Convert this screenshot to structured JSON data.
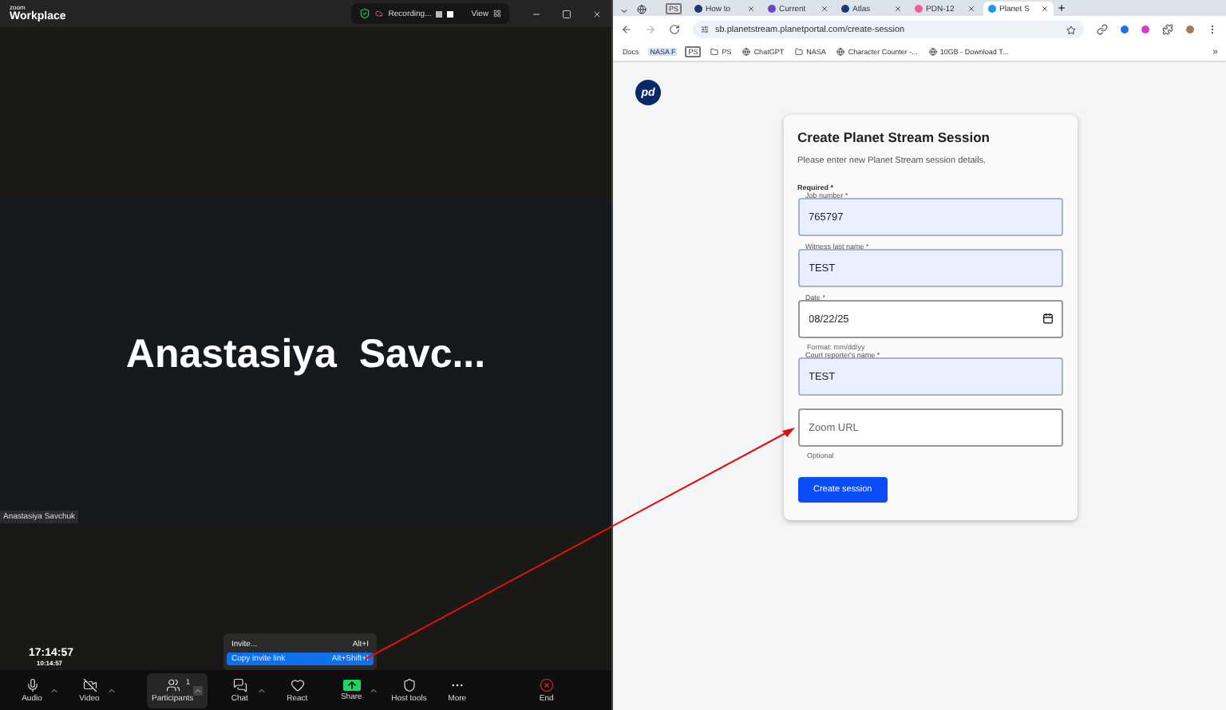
{
  "zoom": {
    "brand_small": "zoom",
    "brand": "Workplace",
    "recording": "Recording...",
    "view": "View",
    "speaker_name": "Anastasiya  Savc...",
    "name_tag": "Anastasiya Savchuk",
    "clock": "17:14:57",
    "clock_secondary": "10:14:57",
    "menu": [
      {
        "label": "Invite...",
        "shortcut": "Alt+I",
        "selected": false
      },
      {
        "label": "Copy invite link",
        "shortcut": "Alt+Shift+I",
        "selected": true
      }
    ],
    "toolbar": [
      {
        "kind": "audio",
        "label": "Audio",
        "caret": true
      },
      {
        "kind": "video",
        "label": "Video",
        "caret": true
      },
      {
        "kind": "participants",
        "label": "Participants",
        "count": "1",
        "caret": true
      },
      {
        "kind": "chat",
        "label": "Chat",
        "caret": true
      },
      {
        "kind": "react",
        "label": "React",
        "caret": false
      },
      {
        "kind": "share",
        "label": "Share",
        "caret": true
      },
      {
        "kind": "host",
        "label": "Host tools",
        "caret": false
      },
      {
        "kind": "more",
        "label": "More",
        "caret": false
      },
      {
        "kind": "end",
        "label": "End",
        "caret": false
      }
    ]
  },
  "browser": {
    "tabs": [
      {
        "kind": "icon",
        "selected": false
      },
      {
        "kind": "badge",
        "label": "PS",
        "selected": false
      },
      {
        "kind": "page",
        "label": "How to",
        "selected": false
      },
      {
        "kind": "page",
        "label": "Current",
        "selected": false
      },
      {
        "kind": "page",
        "label": "Atlas",
        "selected": false
      },
      {
        "kind": "page",
        "label": "PDN-12",
        "selected": false
      },
      {
        "kind": "page",
        "label": "Planet S",
        "selected": true
      }
    ],
    "url": "sb.planetstream.planetportal.com/create-session",
    "bookmarks": [
      {
        "kind": "plain",
        "label": "Docs"
      },
      {
        "kind": "tag",
        "label": "NASA F"
      },
      {
        "kind": "outlined",
        "label": "PS"
      },
      {
        "kind": "folder",
        "label": "PS"
      },
      {
        "kind": "site",
        "label": "ChatGPT"
      },
      {
        "kind": "folder",
        "label": "NASA"
      },
      {
        "kind": "site",
        "label": "Character Counter -..."
      },
      {
        "kind": "site",
        "label": "10GB - Download T..."
      }
    ],
    "more_bookmarks": "»",
    "logo": "pd"
  },
  "form": {
    "title": "Create Planet Stream Session",
    "subtitle": "Please enter new Planet Stream session details.",
    "required_note": "Required *",
    "fields": [
      {
        "kind": "text",
        "label": "Job number *",
        "value": "765797",
        "autofilled": true
      },
      {
        "kind": "text",
        "label": "Witness last name *",
        "value": "TEST",
        "autofilled": true
      },
      {
        "kind": "date",
        "label": "Date *",
        "value": "08/22/25",
        "autofilled": false,
        "helper": "Format: mm/dd/yy"
      },
      {
        "kind": "text",
        "label": "Court reporter's name *",
        "value": "TEST",
        "autofilled": true
      },
      {
        "kind": "text",
        "placeholder": "Zoom URL",
        "autofilled": false,
        "helper": "Optional"
      }
    ],
    "submit": "Create session"
  }
}
